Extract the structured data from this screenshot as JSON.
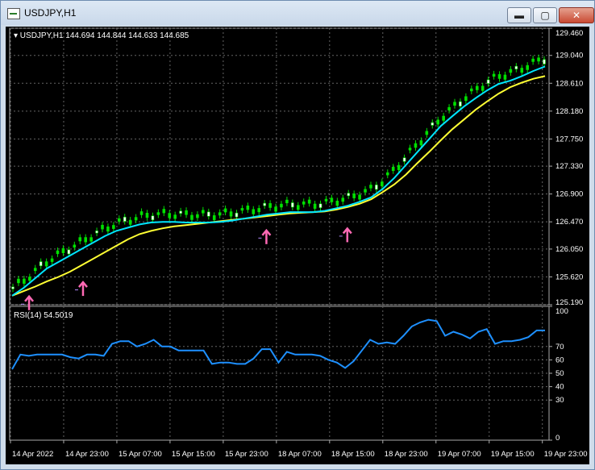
{
  "window": {
    "title": "USDJPY,H1",
    "buttons": {
      "minimize": "▬",
      "maximize": "▢",
      "close": "✕"
    }
  },
  "chart": {
    "header": "▾ USDJPY,H1  144.694 144.844 144.633 144.685",
    "price_ticks": [
      "129.460",
      "129.040",
      "128.610",
      "128.180",
      "127.750",
      "127.330",
      "126.900",
      "126.470",
      "126.050",
      "125.620",
      "125.190"
    ],
    "rsi_label": "RSI(14) 54.5019",
    "rsi_ticks": [
      "100",
      "70",
      "60",
      "50",
      "40",
      "30",
      "0"
    ],
    "time_ticks": [
      "14 Apr 2022",
      "14 Apr 23:00",
      "15 Apr 07:00",
      "15 Apr 15:00",
      "15 Apr 23:00",
      "18 Apr 07:00",
      "18 Apr 15:00",
      "18 Apr 23:00",
      "19 Apr 07:00",
      "19 Apr 15:00",
      "19 Apr 23:00"
    ],
    "colors": {
      "bull": "#00e000",
      "bear": "#00e000",
      "ma_fast": "#00e5ff",
      "ma_slow": "#ffff33",
      "rsi": "#1e90ff",
      "arrow": "#ff69b4",
      "grid": "#646464",
      "marker": "#b58cff"
    }
  },
  "chart_data": [
    {
      "type": "line",
      "title": "USDJPY,H1",
      "ylim": [
        125.19,
        129.46
      ],
      "series": [
        {
          "name": "ma_fast",
          "values": [
            125.33,
            125.45,
            125.6,
            125.75,
            125.85,
            125.95,
            126.05,
            126.15,
            126.25,
            126.33,
            126.38,
            126.43,
            126.46,
            126.47,
            126.47,
            126.46,
            126.46,
            126.46,
            126.47,
            126.49,
            126.52,
            126.55,
            126.58,
            126.6,
            126.62,
            126.62,
            126.62,
            126.64,
            126.68,
            126.72,
            126.78,
            126.85,
            126.98,
            127.15,
            127.35,
            127.55,
            127.75,
            127.95,
            128.1,
            128.25,
            128.38,
            128.5,
            128.6,
            128.65,
            128.72,
            128.8,
            128.87
          ]
        },
        {
          "name": "ma_slow",
          "values": [
            125.33,
            125.4,
            125.47,
            125.55,
            125.62,
            125.7,
            125.8,
            125.9,
            126.0,
            126.1,
            126.2,
            126.28,
            126.33,
            126.37,
            126.4,
            126.42,
            126.44,
            126.46,
            126.48,
            126.5,
            126.52,
            126.54,
            126.56,
            126.58,
            126.6,
            126.61,
            126.62,
            126.63,
            126.66,
            126.7,
            126.75,
            126.82,
            126.93,
            127.05,
            127.2,
            127.38,
            127.55,
            127.73,
            127.9,
            128.05,
            128.2,
            128.33,
            128.45,
            128.55,
            128.62,
            128.68,
            128.72
          ]
        }
      ]
    },
    {
      "type": "line",
      "title": "RSI(14) 54.5019",
      "ylim": [
        0,
        100
      ],
      "series": [
        {
          "name": "RSI(14)",
          "values": [
            53,
            64,
            63,
            64,
            64,
            64,
            64,
            62,
            61,
            64,
            64,
            63,
            72,
            74,
            74,
            70,
            72,
            75,
            70,
            70,
            67,
            67,
            67,
            67,
            57,
            58,
            58,
            57,
            57,
            61,
            68,
            68,
            58,
            66,
            64,
            64,
            64,
            63,
            60,
            58,
            54,
            59,
            67,
            75,
            72,
            73,
            72,
            78,
            85,
            88,
            90,
            89,
            78,
            81,
            79,
            76,
            81,
            83,
            72,
            74,
            74,
            75,
            77,
            82,
            82
          ]
        }
      ]
    }
  ]
}
